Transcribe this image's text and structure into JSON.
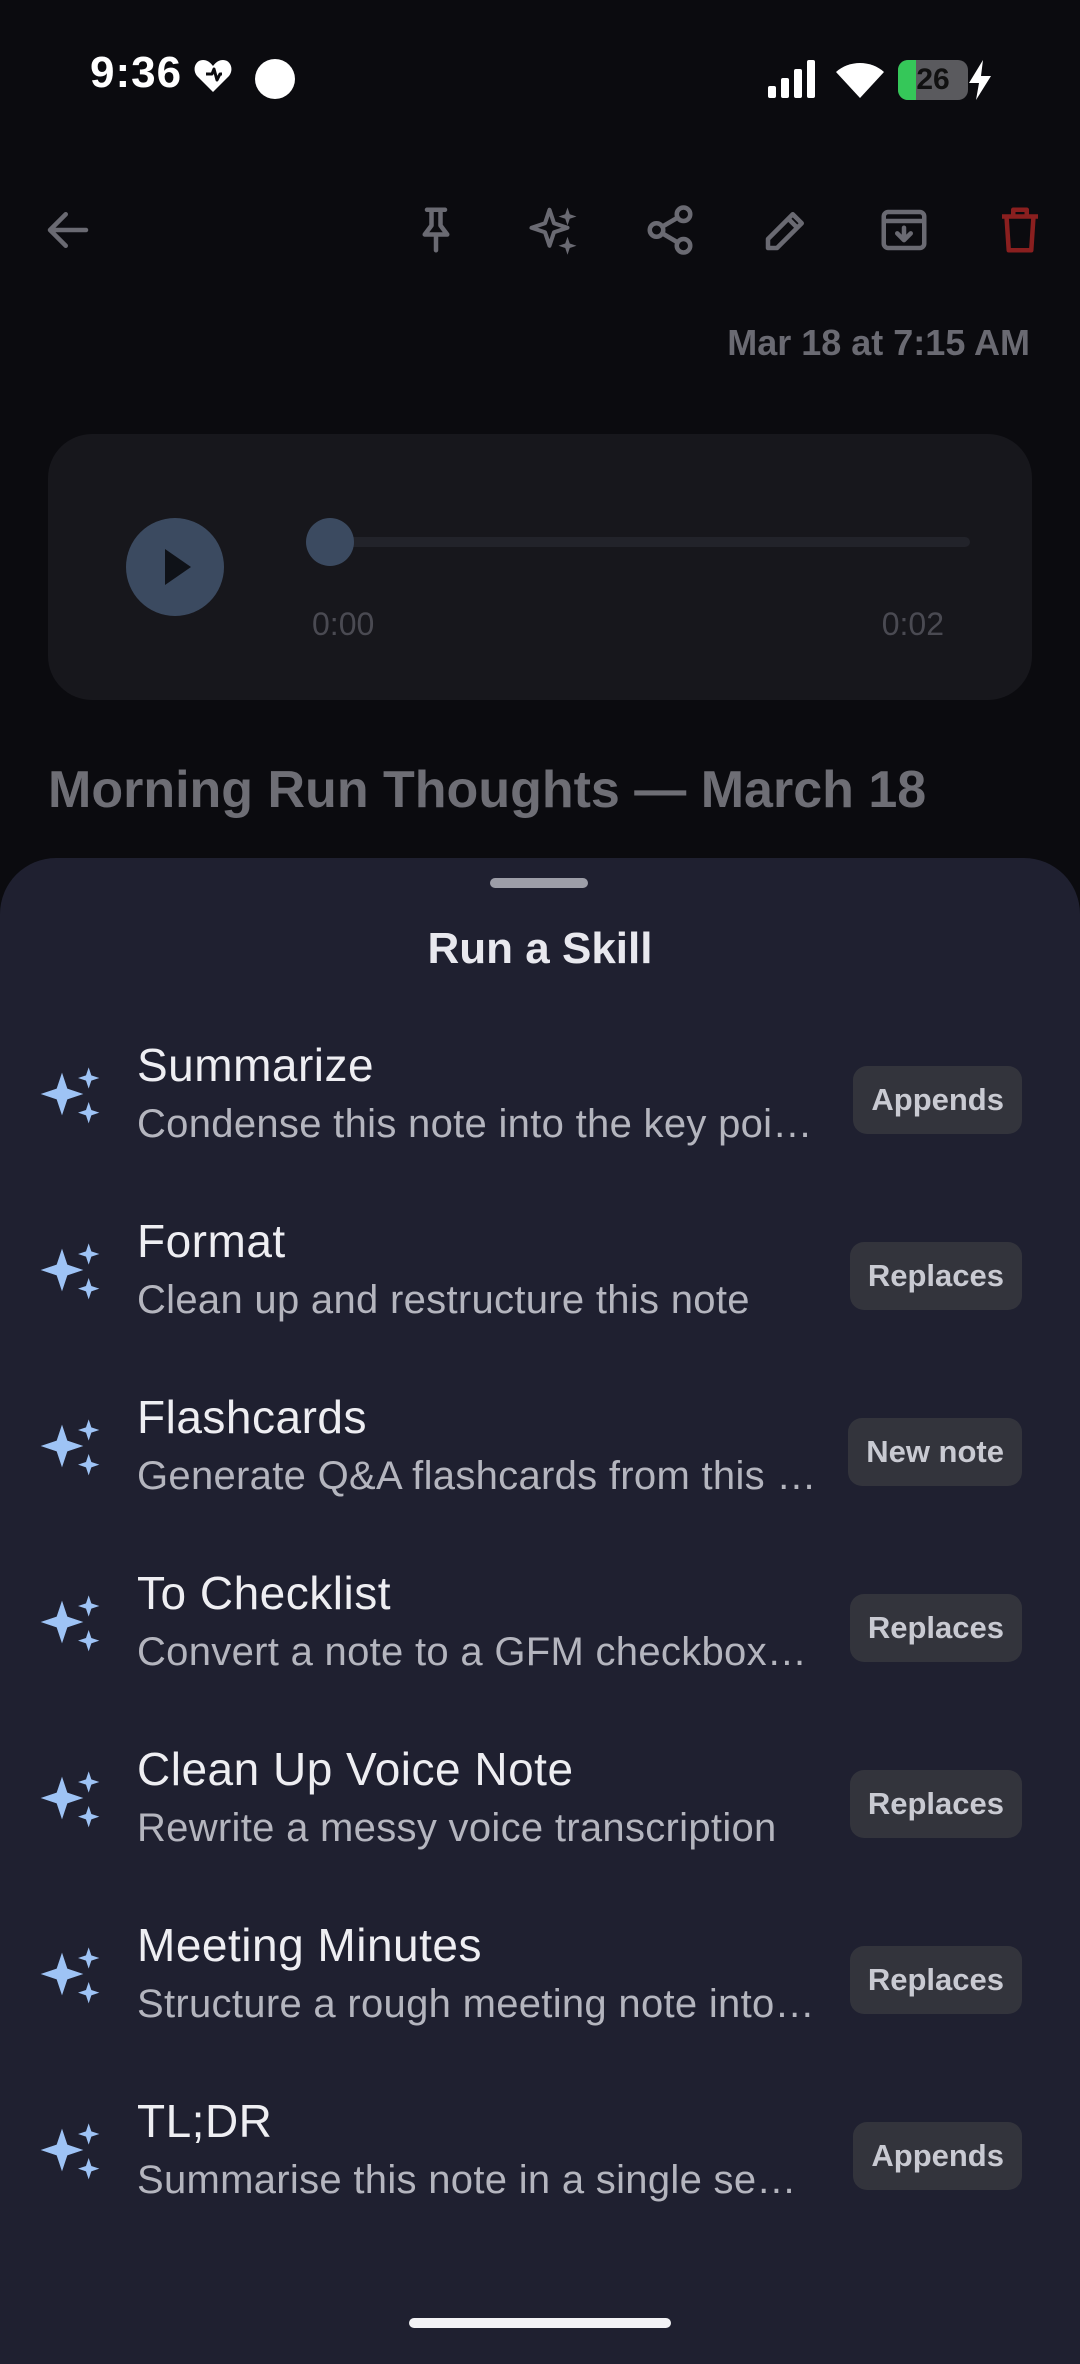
{
  "status_bar": {
    "time": "9:36",
    "battery_level": "26",
    "battery_fraction": 0.26,
    "icons": [
      "heart-icon",
      "circle-dot-icon",
      "signal-icon",
      "wifi-icon",
      "battery-icon",
      "charging-bolt-icon"
    ]
  },
  "toolbar": {
    "icons": [
      "back-arrow-icon",
      "pin-icon",
      "sparkle-ai-icon",
      "share-icon",
      "edit-pencil-icon",
      "archive-icon",
      "delete-trash-icon"
    ],
    "delete_color": "#8a1f1f"
  },
  "note": {
    "date": "Mar 18 at 7:15 AM",
    "title": "Morning Run Thoughts — March 18"
  },
  "audio_player": {
    "current_time": "0:00",
    "duration": "0:02",
    "progress": 0.0
  },
  "sheet": {
    "title": "Run a Skill",
    "skills": [
      {
        "name": "Summarize",
        "description": "Condense this note into the key points",
        "badge": "Appends"
      },
      {
        "name": "Format",
        "description": "Clean up and restructure this note",
        "badge": "Replaces"
      },
      {
        "name": "Flashcards",
        "description": "Generate Q&A flashcards from this note",
        "badge": "New note"
      },
      {
        "name": "To Checklist",
        "description": "Convert a note to a GFM checkbox list",
        "badge": "Replaces"
      },
      {
        "name": "Clean Up Voice Note",
        "description": "Rewrite a messy voice transcription",
        "badge": "Replaces"
      },
      {
        "name": "Meeting Minutes",
        "description": "Structure a rough meeting note into minutes",
        "badge": "Replaces"
      },
      {
        "name": "TL;DR",
        "description": "Summarise this note in a single sentence",
        "badge": "Appends"
      }
    ]
  },
  "colors": {
    "background": "#0b0b0f",
    "sheet": "#1f2030",
    "accent_sparkle": "#9ec3f5",
    "badge_bg": "#33343c"
  }
}
